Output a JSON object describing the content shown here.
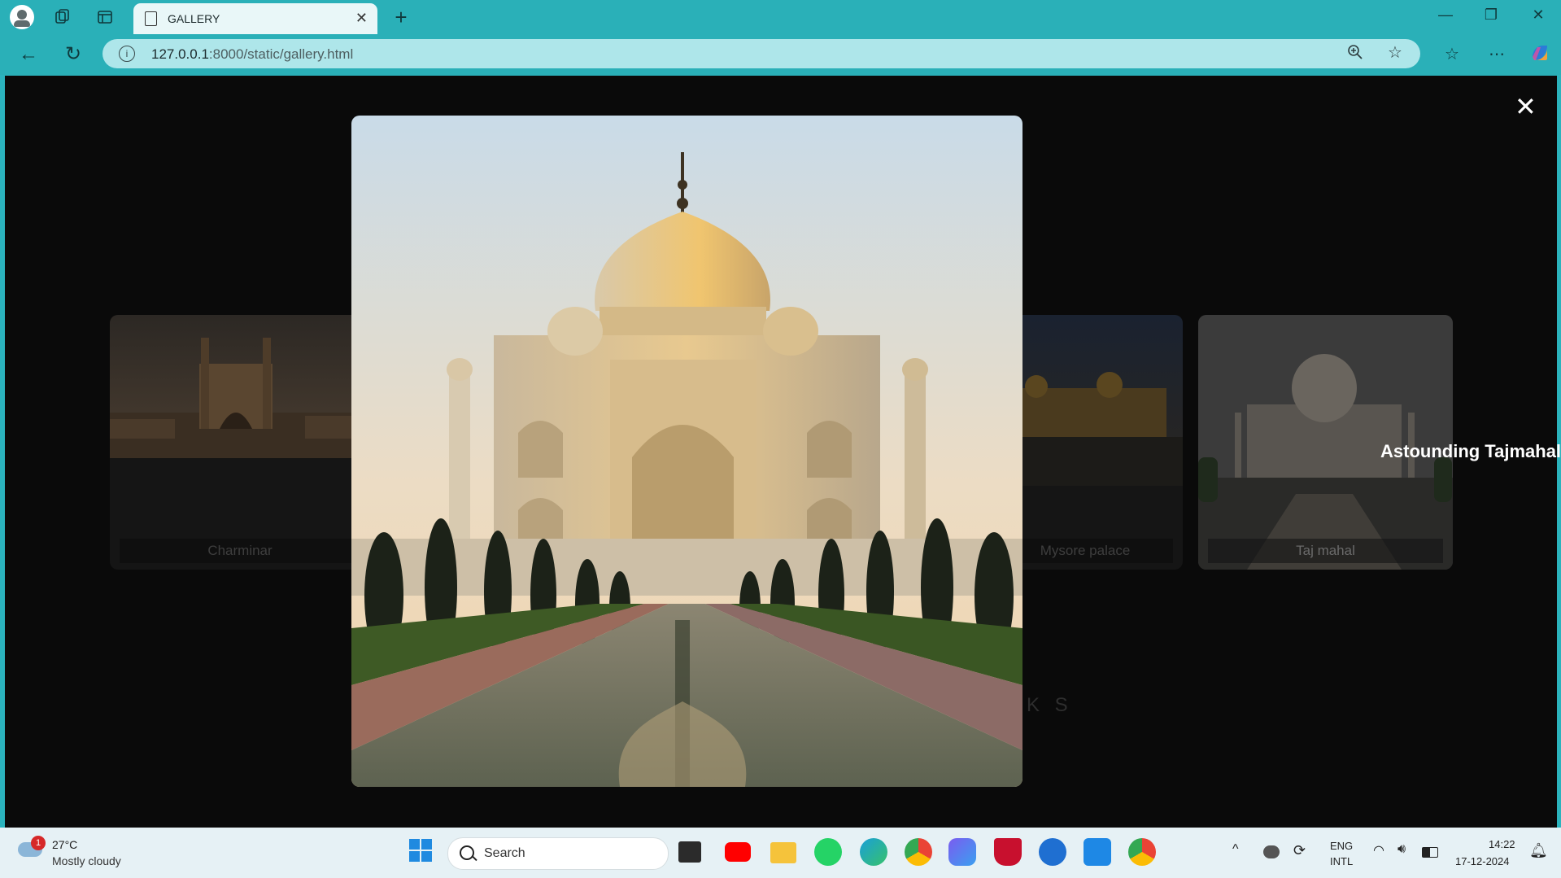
{
  "browser": {
    "tab_title": "GALLERY",
    "tab_close": "✕",
    "new_tab": "+",
    "url_host": "127.0.0.1",
    "url_rest": ":8000/static/gallery.html",
    "minimize": "—",
    "restore": "❐",
    "close": "✕"
  },
  "gallery": {
    "cards": [
      {
        "label": "Charminar"
      },
      {
        "label": "Mysore palace"
      },
      {
        "label": "Taj mahal"
      }
    ],
    "hover_caption": "Astounding Tajmahal",
    "ghost_heading": "K S",
    "lightbox_close": "✕"
  },
  "taskbar": {
    "weather_badge": "1",
    "temperature": "27°C",
    "weather": "Mostly cloudy",
    "search_placeholder": "Search",
    "language_top": "ENG",
    "language_bottom": "INTL",
    "time": "14:22",
    "date": "17-12-2024"
  },
  "colors": {
    "browser_chrome": "#2ab0b8",
    "omnibox": "#aee6ea",
    "page_bg": "#0a0a0a",
    "taskbar": "#e6f1f5"
  }
}
